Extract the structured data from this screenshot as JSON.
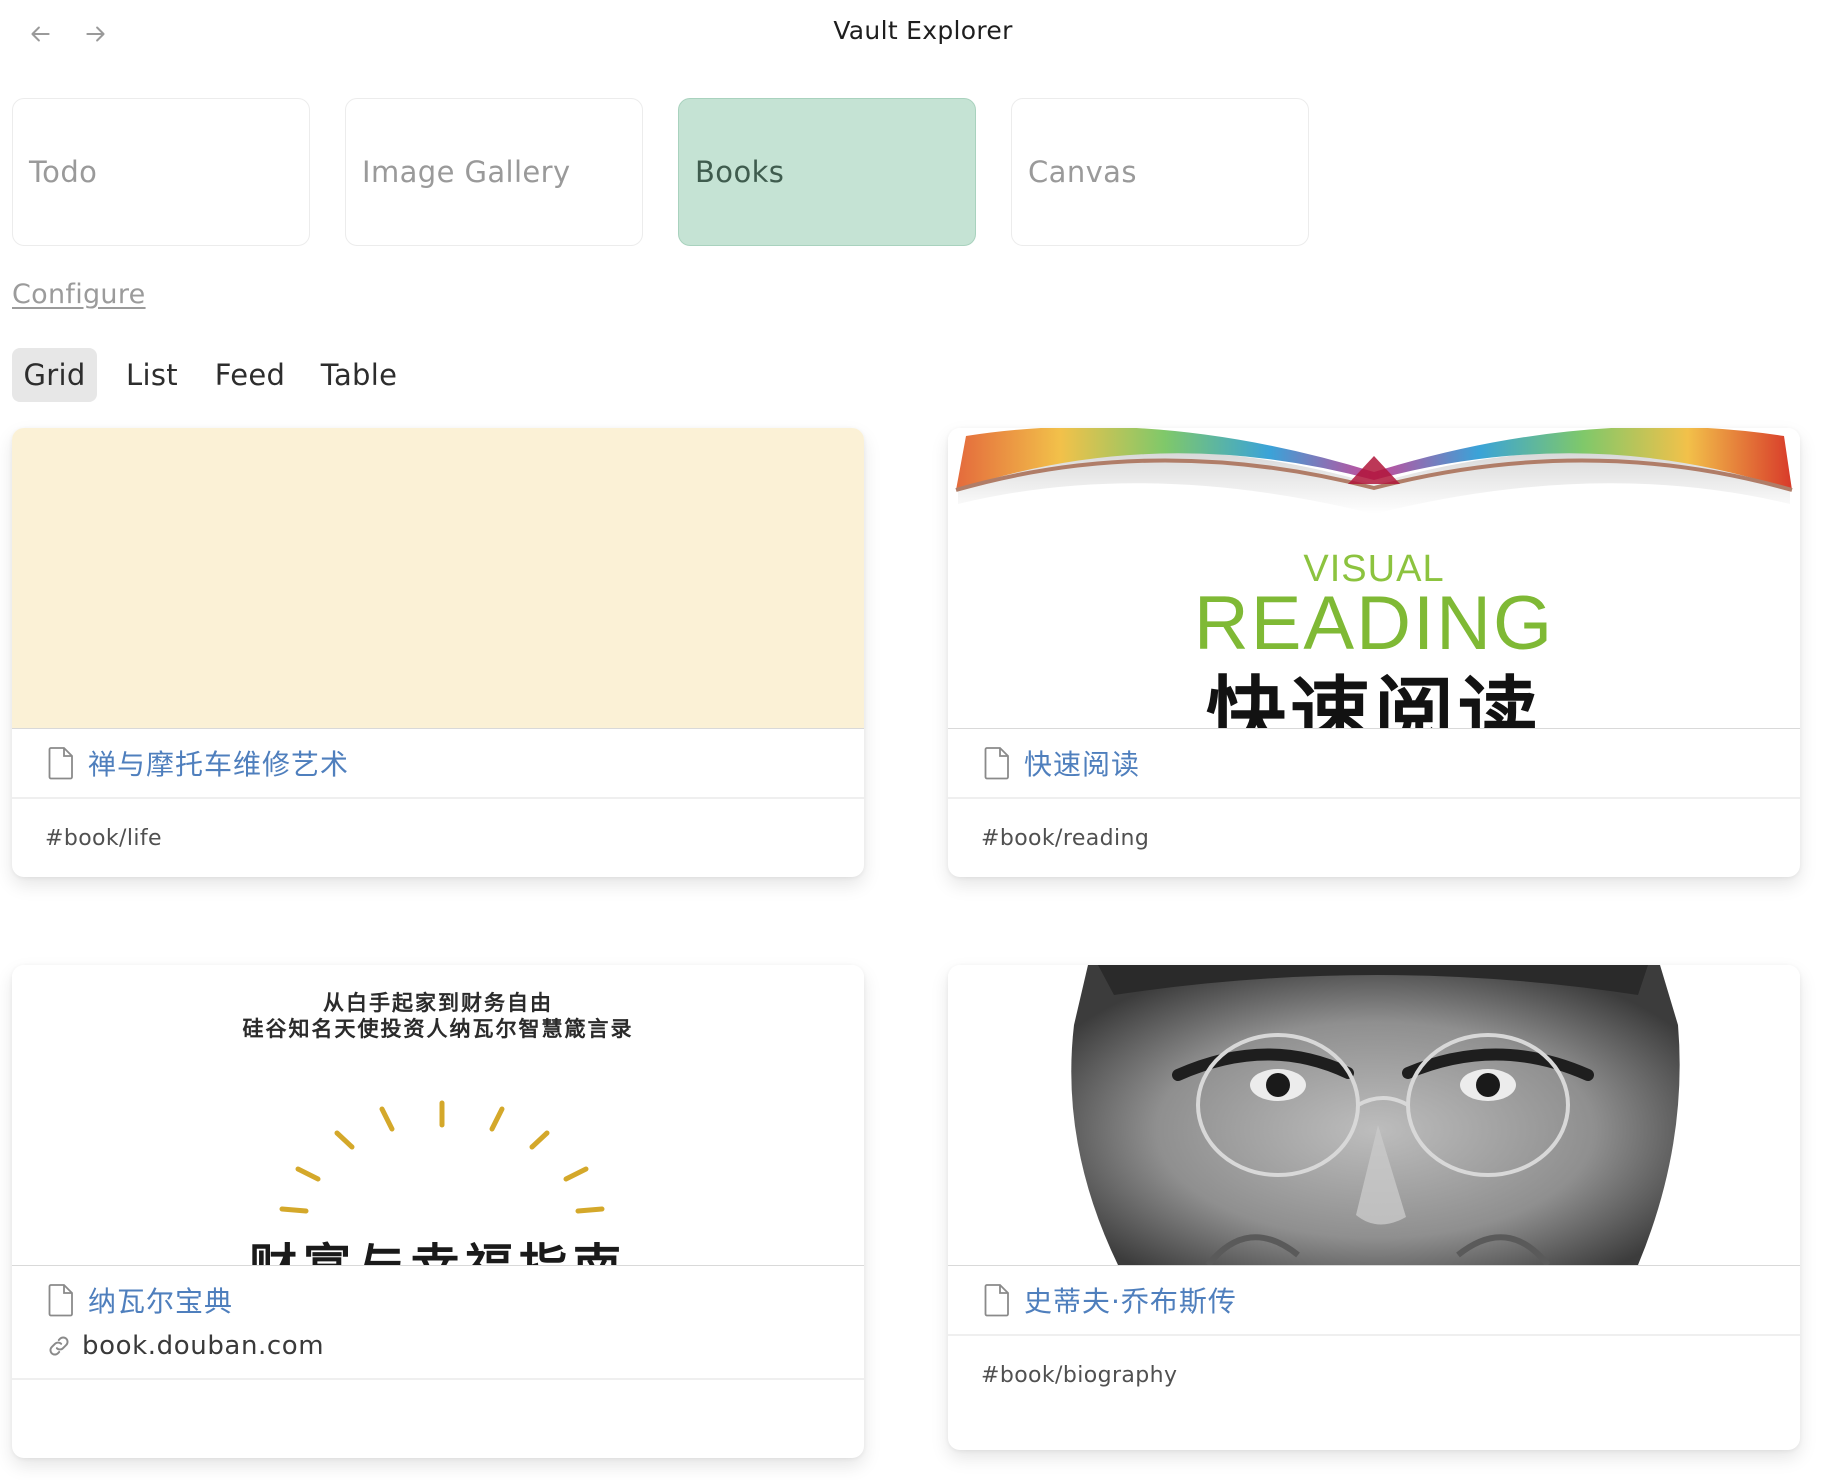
{
  "window": {
    "title": "Vault Explorer",
    "back_icon": "arrow-left-icon",
    "forward_icon": "arrow-right-icon"
  },
  "views": [
    {
      "label": "Todo",
      "active": false
    },
    {
      "label": "Image Gallery",
      "active": false
    },
    {
      "label": "Books",
      "active": true
    },
    {
      "label": "Canvas",
      "active": false
    }
  ],
  "configure_label": "Configure",
  "tabs": [
    {
      "label": "Grid",
      "active": true
    },
    {
      "label": "List",
      "active": false
    },
    {
      "label": "Feed",
      "active": false
    },
    {
      "label": "Table",
      "active": false
    }
  ],
  "cards": [
    {
      "title": "禅与摩托车维修艺术",
      "tag": "#book/life",
      "url": "",
      "cover": "plain-cream",
      "cover_color": "#fbf1d6"
    },
    {
      "title": "快速阅读",
      "tag": "#book/reading",
      "url": "",
      "cover": "visual-reading",
      "cover_text": {
        "line1": "VISUAL",
        "line2": "READING",
        "line3": "快速阅读"
      }
    },
    {
      "title": "纳瓦尔宝典",
      "tag": "",
      "url": "book.douban.com",
      "cover": "sunrise-book",
      "cover_text": {
        "line1": "从白手起家到财务自由",
        "line2": "硅谷知名天使投资人纳瓦尔智慧箴言录",
        "line3": "财富与幸福指南"
      }
    },
    {
      "title": "史蒂夫·乔布斯传",
      "tag": "#book/biography",
      "url": "",
      "cover": "portrait"
    }
  ],
  "colors": {
    "active_tile": "#c5e3d4",
    "link": "#4f7fbd",
    "accent_gold": "#d4a82a",
    "visual_green": "#8cc33f"
  }
}
